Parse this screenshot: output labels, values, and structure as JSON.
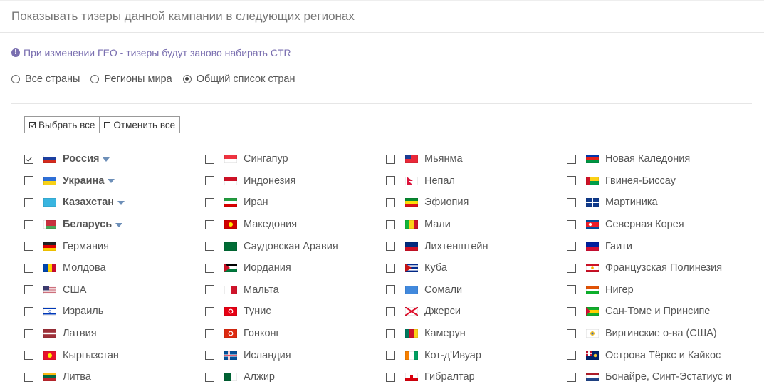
{
  "panel": {
    "title": "Показывать тизеры данной кампании в следующих регионах",
    "info_text": "При изменении ГЕО - тизеры будут заново набирать CTR",
    "info_icon": "!"
  },
  "geo_mode": {
    "options": [
      {
        "label": "Все страны",
        "checked": false
      },
      {
        "label": "Регионы мира",
        "checked": false
      },
      {
        "label": "Общий список стран",
        "checked": true
      }
    ]
  },
  "actions": {
    "select_all": "Выбрать все",
    "deselect_all": "Отменить все"
  },
  "countries": [
    {
      "name": "Россия",
      "checked": true,
      "bold": true,
      "expandable": true,
      "flag": [
        "#ffffff",
        "#1c3fa0",
        "#d52b1e"
      ],
      "flag_type": "h"
    },
    {
      "name": "Украина",
      "checked": false,
      "bold": true,
      "expandable": true,
      "flag": [
        "#2f6fd6",
        "#f7d117"
      ],
      "flag_type": "h"
    },
    {
      "name": "Казахстан",
      "checked": false,
      "bold": true,
      "expandable": true,
      "flag": [
        "#39b5e0"
      ],
      "flag_type": "solid"
    },
    {
      "name": "Беларусь",
      "checked": false,
      "bold": true,
      "expandable": true,
      "flag": [
        "#c8313e",
        "#4aa657"
      ],
      "flag_type": "by"
    },
    {
      "name": "Германия",
      "checked": false,
      "flag": [
        "#222222",
        "#dd0000",
        "#ffce00"
      ],
      "flag_type": "h"
    },
    {
      "name": "Молдова",
      "checked": false,
      "flag": [
        "#0046ae",
        "#ffd200",
        "#cc092f"
      ],
      "flag_type": "v"
    },
    {
      "name": "США",
      "checked": false,
      "flag": [
        "#b22234",
        "#ffffff",
        "#3c3b6e"
      ],
      "flag_type": "us"
    },
    {
      "name": "Израиль",
      "checked": false,
      "flag": [
        "#ffffff",
        "#0038b8"
      ],
      "flag_type": "il"
    },
    {
      "name": "Латвия",
      "checked": false,
      "flag": [
        "#9e3039",
        "#ffffff"
      ],
      "flag_type": "lv"
    },
    {
      "name": "Кыргызстан",
      "checked": false,
      "flag": [
        "#e8112d",
        "#ffef00"
      ],
      "flag_type": "sun"
    },
    {
      "name": "Литва",
      "checked": false,
      "flag": [
        "#fdb913",
        "#006a44",
        "#c1272d"
      ],
      "flag_type": "h"
    },
    {
      "name": "Сингапур",
      "checked": false,
      "flag": [
        "#ef3340",
        "#ffffff"
      ],
      "flag_type": "h"
    },
    {
      "name": "Индонезия",
      "checked": false,
      "flag": [
        "#ce1126",
        "#ffffff"
      ],
      "flag_type": "h"
    },
    {
      "name": "Иран",
      "checked": false,
      "flag": [
        "#239f40",
        "#ffffff",
        "#da0000"
      ],
      "flag_type": "h"
    },
    {
      "name": "Македония",
      "checked": false,
      "flag": [
        "#d20000",
        "#ffe600"
      ],
      "flag_type": "sun"
    },
    {
      "name": "Саудовская Аравия",
      "checked": false,
      "flag": [
        "#006c35"
      ],
      "flag_type": "solid"
    },
    {
      "name": "Иордания",
      "checked": false,
      "flag": [
        "#000000",
        "#ffffff",
        "#007a3d",
        "#ce1126"
      ],
      "flag_type": "tri"
    },
    {
      "name": "Мальта",
      "checked": false,
      "flag": [
        "#ffffff",
        "#cf142b"
      ],
      "flag_type": "v2"
    },
    {
      "name": "Тунис",
      "checked": false,
      "flag": [
        "#e70013",
        "#ffffff"
      ],
      "flag_type": "disc"
    },
    {
      "name": "Гонконг",
      "checked": false,
      "flag": [
        "#de2910",
        "#ffffff"
      ],
      "flag_type": "disc"
    },
    {
      "name": "Исландия",
      "checked": false,
      "flag": [
        "#02529c",
        "#dc1e35"
      ],
      "flag_type": "nordic"
    },
    {
      "name": "Алжир",
      "checked": false,
      "flag": [
        "#006233",
        "#ffffff"
      ],
      "flag_type": "v2"
    },
    {
      "name": "Мьянма",
      "checked": false,
      "flag": [
        "#ea2839",
        "#1c3d94"
      ],
      "flag_type": "canton"
    },
    {
      "name": "Непал",
      "checked": false,
      "flag": [
        "#dc143c",
        "#003893"
      ],
      "flag_type": "np"
    },
    {
      "name": "Эфиопия",
      "checked": false,
      "flag": [
        "#078930",
        "#fcdd09",
        "#da121a"
      ],
      "flag_type": "h"
    },
    {
      "name": "Мали",
      "checked": false,
      "flag": [
        "#14b53a",
        "#fcd116",
        "#ce1126"
      ],
      "flag_type": "v"
    },
    {
      "name": "Лихтенштейн",
      "checked": false,
      "flag": [
        "#002b7f",
        "#ce1126"
      ],
      "flag_type": "h"
    },
    {
      "name": "Куба",
      "checked": false,
      "flag": [
        "#002a8f",
        "#ffffff",
        "#cb1515"
      ],
      "flag_type": "cu"
    },
    {
      "name": "Сомали",
      "checked": false,
      "flag": [
        "#4189dd"
      ],
      "flag_type": "solid"
    },
    {
      "name": "Джерси",
      "checked": false,
      "flag": [
        "#ffffff",
        "#df112d"
      ],
      "flag_type": "saltire"
    },
    {
      "name": "Камерун",
      "checked": false,
      "flag": [
        "#007a5e",
        "#ce1126",
        "#fcd116"
      ],
      "flag_type": "v"
    },
    {
      "name": "Кот-д'Ивуар",
      "checked": false,
      "flag": [
        "#f77f00",
        "#ffffff",
        "#009e60"
      ],
      "flag_type": "v"
    },
    {
      "name": "Гибралтар",
      "checked": false,
      "flag": [
        "#ffffff",
        "#da000c"
      ],
      "flag_type": "gi"
    },
    {
      "name": "Новая Каледония",
      "checked": false,
      "flag": [
        "#0035ad",
        "#e2231a",
        "#009543"
      ],
      "flag_type": "h"
    },
    {
      "name": "Гвинея-Биссау",
      "checked": false,
      "flag": [
        "#ce1126",
        "#fcd116",
        "#009e49"
      ],
      "flag_type": "gw"
    },
    {
      "name": "Мартиника",
      "checked": false,
      "flag": [
        "#0f3a8c",
        "#ffffff"
      ],
      "flag_type": "cross"
    },
    {
      "name": "Северная Корея",
      "checked": false,
      "flag": [
        "#024fa2",
        "#ed1c27",
        "#ffffff"
      ],
      "flag_type": "kp"
    },
    {
      "name": "Гаити",
      "checked": false,
      "flag": [
        "#00209f",
        "#d21034"
      ],
      "flag_type": "h"
    },
    {
      "name": "Французская Полинезия",
      "checked": false,
      "flag": [
        "#ce1126",
        "#ffffff"
      ],
      "flag_type": "pf"
    },
    {
      "name": "Нигер",
      "checked": false,
      "flag": [
        "#e05206",
        "#ffffff",
        "#0db02b"
      ],
      "flag_type": "h"
    },
    {
      "name": "Сан-Томе и Принсипе",
      "checked": false,
      "flag": [
        "#12ad2b",
        "#ffce00",
        "#d21034"
      ],
      "flag_type": "st"
    },
    {
      "name": "Виргинские о-ва (США)",
      "checked": false,
      "flag": [
        "#ffffff",
        "#f2c230",
        "#3366cc"
      ],
      "flag_type": "vi"
    },
    {
      "name": "Острова Тёркс и Кайкос",
      "checked": false,
      "flag": [
        "#012169",
        "#f2c230"
      ],
      "flag_type": "ensign"
    },
    {
      "name": "Бонайре, Синт-Эстатиус и",
      "checked": false,
      "flag": [
        "#ae1c28",
        "#ffffff",
        "#21468b"
      ],
      "flag_type": "h"
    }
  ],
  "colors": {
    "info": "#7a6fb0",
    "caret": "#6d8fb8",
    "text": "#555555"
  }
}
